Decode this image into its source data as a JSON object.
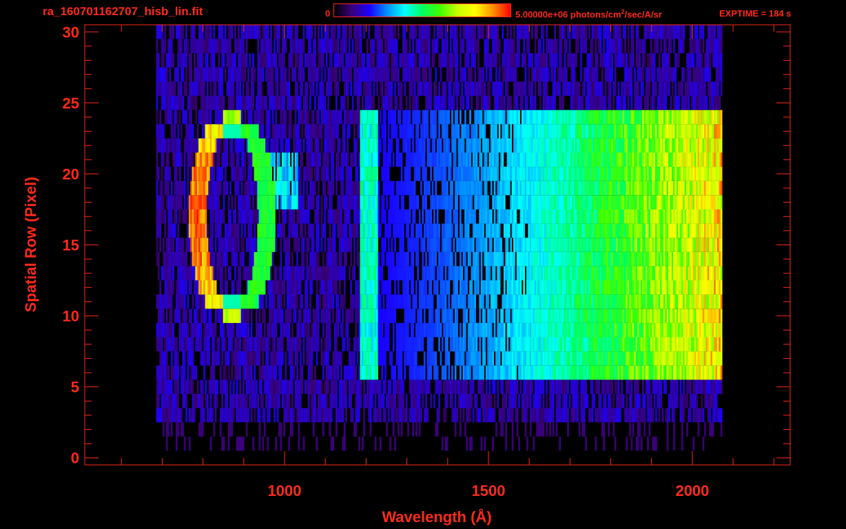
{
  "header": {
    "file_title": "ra_160701162707_hisb_lin.fit",
    "colorbar_min": "0",
    "colorbar_max_prefix": "5.00000e+06 photons/cm",
    "colorbar_max_sup": "2",
    "colorbar_max_suffix": "/sec/A/sr",
    "exptime": "EXPTIME = 184 s"
  },
  "colors": {
    "foreground": "#ff2a1a",
    "background": "#000000",
    "colormap": [
      "#000000",
      "#3a007a",
      "#1a00ff",
      "#0090ff",
      "#00ffff",
      "#00ff60",
      "#40ff00",
      "#c8ff00",
      "#ffff00",
      "#ff9000",
      "#ff0000"
    ]
  },
  "chart_data": {
    "type": "heatmap",
    "title": "",
    "xlabel": "Wavelength (Å)",
    "ylabel": "Spatial Row (Pixel)",
    "xlim": [
      510,
      2240
    ],
    "ylim": [
      -0.5,
      30.5
    ],
    "x_ticks": [
      1000,
      1500,
      2000
    ],
    "x_tick_labels": [
      "1000",
      "1500",
      "2000"
    ],
    "y_ticks": [
      0,
      5,
      10,
      15,
      20,
      25,
      30
    ],
    "y_tick_labels": [
      "0",
      "5",
      "10",
      "15",
      "20",
      "25",
      "30"
    ],
    "colorbar_range": [
      0,
      5000000
    ],
    "colorbar_units": "photons/cm^2/sec/A/sr",
    "data_wavelength_range": [
      685,
      2070
    ],
    "features": [
      {
        "x_range": [
          775,
          955
        ],
        "y_range": [
          10,
          24
        ],
        "shape": "ring",
        "peak": 1.0
      },
      {
        "x_range": [
          940,
          1030
        ],
        "y_range": [
          18,
          21
        ],
        "shape": "band",
        "peak": 0.45
      },
      {
        "x_range": [
          1185,
          1225
        ],
        "y_range": [
          6,
          24
        ],
        "shape": "vertical-band",
        "peak": 0.5
      },
      {
        "x_range": [
          1225,
          2070
        ],
        "y_range": [
          6,
          24
        ],
        "shape": "continuum",
        "peak": 0.75
      }
    ]
  }
}
